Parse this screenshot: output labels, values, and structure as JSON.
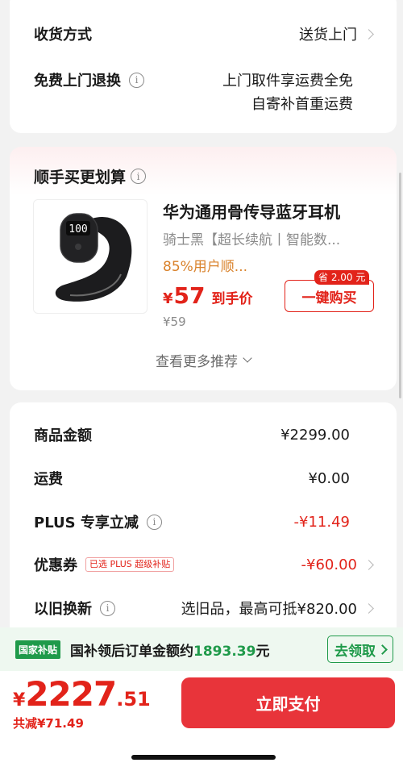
{
  "delivery": {
    "method_label": "收货方式",
    "method_value": "送货上门",
    "return_label": "免费上门退换",
    "return_line1": "上门取件享运费全免",
    "return_line2": "自寄补首重运费"
  },
  "addon": {
    "section_title": "顺手买更划算",
    "product_title": "华为通用骨传导蓝牙耳机",
    "product_spec": "骑士黑【超长续航丨智能数...",
    "product_rating": "85%用户顺...",
    "earbud_display": "100",
    "price_symbol": "¥",
    "price": "57",
    "price_tag": "到手价",
    "original_price": "¥59",
    "save_badge": "省 2.00 元",
    "buy_button": "一键购买",
    "more_link": "查看更多推荐"
  },
  "summary": {
    "rows": [
      {
        "label": "商品金额",
        "value": "¥2299.00"
      },
      {
        "label": "运费",
        "value": "¥0.00"
      },
      {
        "label": "PLUS 专享立减",
        "value": "-¥11.49"
      },
      {
        "label": "优惠券",
        "tag": "已选 PLUS 超级补贴",
        "value": "-¥60.00"
      },
      {
        "label": "以旧换新",
        "value": "选旧品，最高可抵¥820.00"
      }
    ]
  },
  "subsidy": {
    "badge": "国家补贴",
    "text_prefix": "国补领后订单金额约",
    "amount": "1893.39",
    "text_suffix": "元",
    "claim_button": "去领取"
  },
  "footer": {
    "currency": "¥",
    "total_int": "2227",
    "total_dec": ".51",
    "saved": "共减¥71.49",
    "pay_button": "立即支付"
  },
  "colors": {
    "accent": "#e2231a",
    "green": "#1f9a4a",
    "pay": "#e8343a"
  }
}
